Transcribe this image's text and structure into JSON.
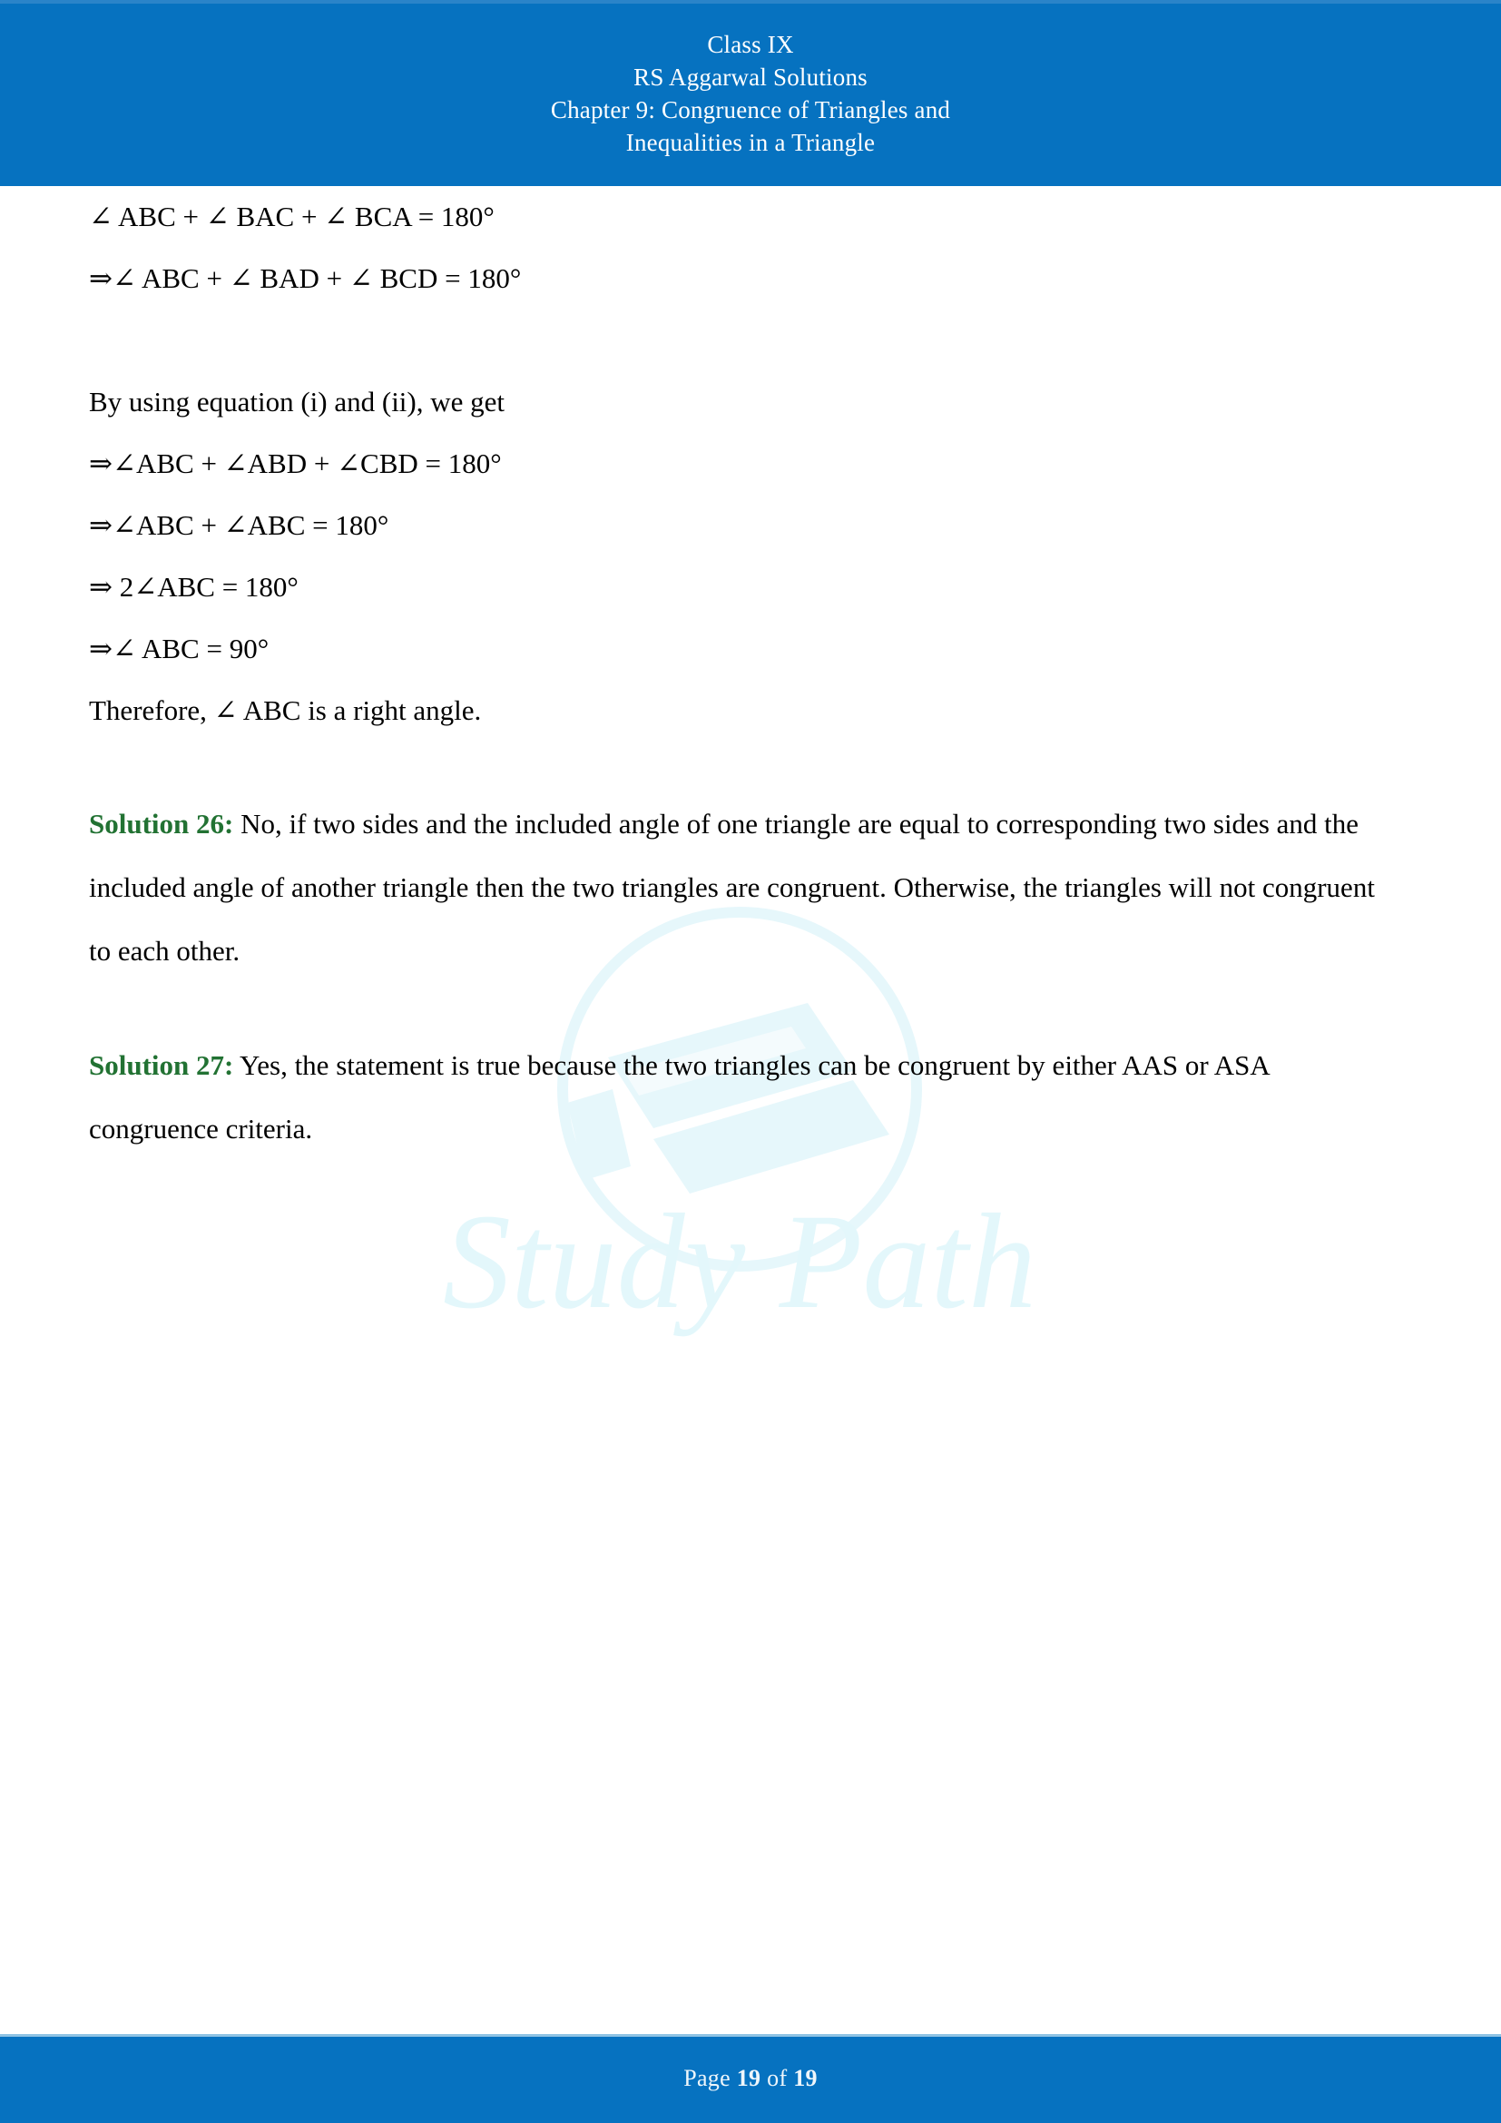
{
  "header": {
    "lines": [
      "Class IX",
      "RS Aggarwal Solutions",
      "Chapter 9: Congruence of Triangles and",
      "Inequalities in a Triangle"
    ]
  },
  "colors": {
    "header_blue": "#0672c0",
    "footer_blue": "#0672c0",
    "solution_label_green": "#227233",
    "watermark_cyan": "#e3f7fb",
    "body_text": "#000000"
  },
  "watermark": {
    "text": "Study Path"
  },
  "content": {
    "equations": [
      "∠ ABC + ∠ BAC + ∠ BCA = 180°",
      "⇒∠ ABC + ∠ BAD + ∠ BCD = 180°"
    ],
    "lead_in": "By using equation (i) and (ii), we get",
    "equations2": [
      "⇒∠ABC + ∠ABD + ∠CBD = 180°",
      "⇒∠ABC + ∠ABC = 180°",
      "⇒ 2∠ABC = 180°",
      "⇒∠ ABC = 90°"
    ],
    "conclusion": "Therefore, ∠ ABC is a right angle.",
    "solutions": [
      {
        "label": "Solution 26:",
        "text": " No, if two sides and the included angle of one triangle are equal to corresponding two sides and the included angle of another triangle then the two triangles are congruent. Otherwise, the triangles will not congruent to each other."
      },
      {
        "label": "Solution 27:",
        "text": " Yes, the statement is true because the two triangles can be congruent by either AAS or ASA congruence criteria."
      }
    ]
  },
  "footer": {
    "prefix": "Page ",
    "current_page": "19",
    "middle": " of ",
    "total_pages": "19"
  }
}
